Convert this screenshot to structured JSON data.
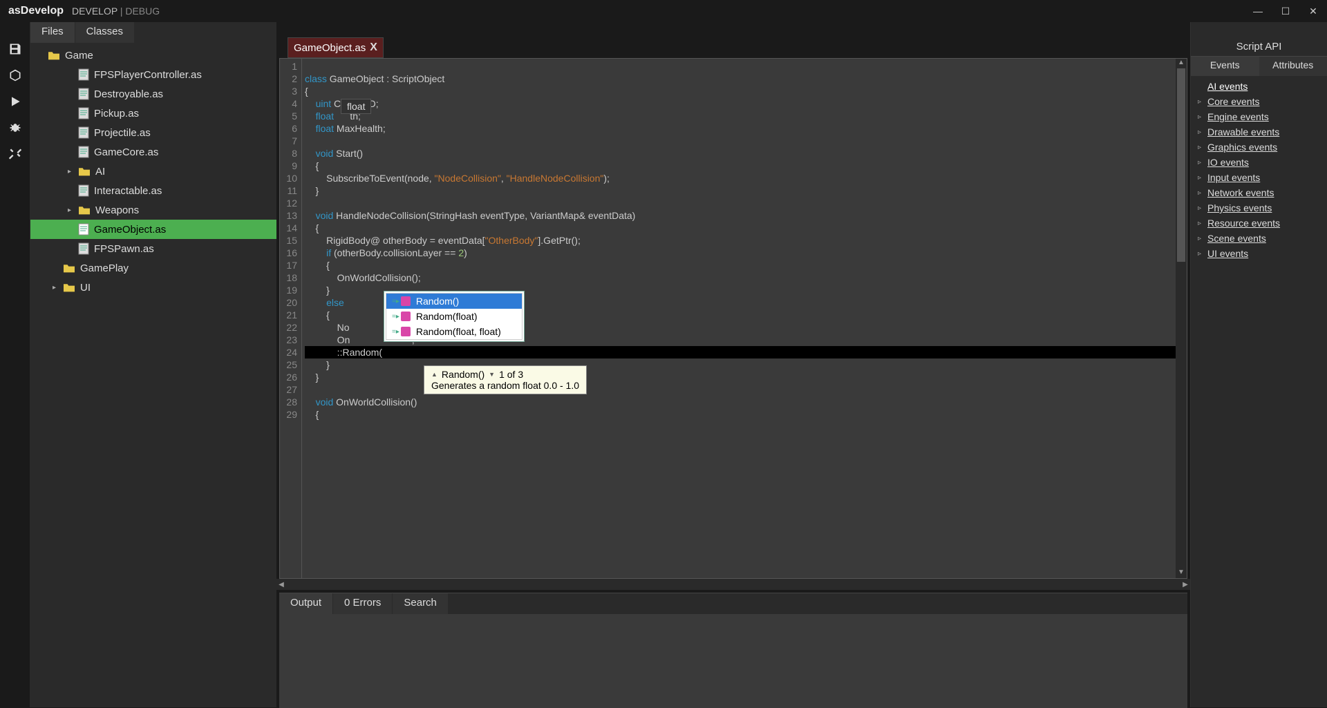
{
  "app": {
    "title": "asDevelop",
    "mode_active": "DEVELOP",
    "mode_sep": " | ",
    "mode_other": "DEBUG"
  },
  "window": {
    "min": "—",
    "max": "☐",
    "close": "✕"
  },
  "left_tabs": [
    "Files",
    "Classes"
  ],
  "tree": {
    "root": "Game",
    "items": [
      {
        "name": "FPSPlayerController.as",
        "indent": 2,
        "type": "file"
      },
      {
        "name": "Destroyable.as",
        "indent": 2,
        "type": "file"
      },
      {
        "name": "Pickup.as",
        "indent": 2,
        "type": "file"
      },
      {
        "name": "Projectile.as",
        "indent": 2,
        "type": "file"
      },
      {
        "name": "GameCore.as",
        "indent": 2,
        "type": "file"
      },
      {
        "name": "AI",
        "indent": 2,
        "type": "folder",
        "exp": true
      },
      {
        "name": "Interactable.as",
        "indent": 2,
        "type": "file"
      },
      {
        "name": "Weapons",
        "indent": 2,
        "type": "folder",
        "exp": true
      },
      {
        "name": "GameObject.as",
        "indent": 2,
        "type": "file",
        "selected": true
      },
      {
        "name": "FPSPawn.as",
        "indent": 2,
        "type": "file"
      },
      {
        "name": "GamePlay",
        "indent": 1,
        "type": "folder"
      },
      {
        "name": "UI",
        "indent": 1,
        "type": "folder",
        "exp": true
      }
    ]
  },
  "editor": {
    "tab": "GameObject.as",
    "tooltip": "float",
    "lines": 29,
    "autocomplete": {
      "items": [
        "Random()",
        "Random(float)",
        "Random(float, float)"
      ],
      "selected": 0
    },
    "signature": {
      "title": "Random()",
      "counter": "1 of 3",
      "desc": "Generates a random float 0.0 - 1.0"
    }
  },
  "bottom_tabs": [
    "Output",
    "0 Errors",
    "Search"
  ],
  "right": {
    "header": "Script API",
    "tabs": [
      "Events",
      "Attributes"
    ],
    "items": [
      "AI events",
      "Core events",
      "Engine events",
      "Drawable events",
      "Graphics events",
      "IO events",
      "Input events",
      "Network events",
      "Physics events",
      "Resource events",
      "Scene events",
      "UI events"
    ]
  }
}
